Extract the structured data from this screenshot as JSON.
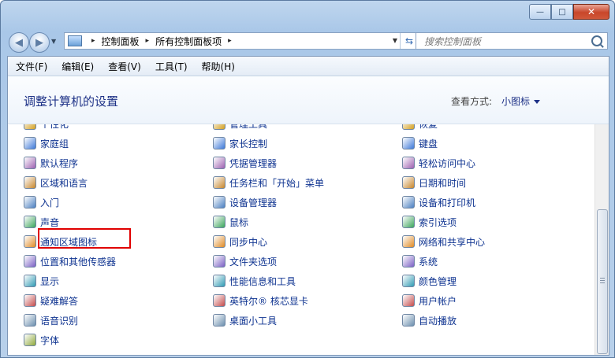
{
  "window": {
    "controls": {
      "minimize": "—",
      "maximize": "□",
      "close": "✕"
    }
  },
  "nav": {
    "back_icon": "arrow-left-icon",
    "forward_icon": "arrow-right-icon",
    "breadcrumb": [
      "控制面板",
      "所有控制面板项"
    ],
    "breadcrumb_sep": "▸",
    "refresh_icon": "refresh-icon"
  },
  "search": {
    "placeholder": "搜索控制面板"
  },
  "menubar": {
    "items": [
      "文件(F)",
      "编辑(E)",
      "查看(V)",
      "工具(T)",
      "帮助(H)"
    ]
  },
  "header": {
    "title": "调整计算机的设置",
    "view_by_label": "查看方式:",
    "view_mode": "小图标"
  },
  "items": {
    "col1": [
      "个性化",
      "家庭组",
      "默认程序",
      "区域和语言",
      "入门",
      "声音",
      "通知区域图标",
      "位置和其他传感器",
      "显示",
      "疑难解答",
      "语音识别",
      "字体"
    ],
    "col2": [
      "管理工具",
      "家长控制",
      "凭据管理器",
      "任务栏和「开始」菜单",
      "设备管理器",
      "鼠标",
      "同步中心",
      "文件夹选项",
      "性能信息和工具",
      "英特尔® 核芯显卡",
      "桌面小工具"
    ],
    "col3": [
      "恢复",
      "键盘",
      "轻松访问中心",
      "日期和时间",
      "设备和打印机",
      "索引选项",
      "网络和共享中心",
      "系统",
      "颜色管理",
      "用户帐户",
      "自动播放"
    ]
  },
  "highlighted_item": "通知区域图标",
  "colors": {
    "link": "#0e3390",
    "title": "#1e3287",
    "highlight": "#e00000"
  }
}
